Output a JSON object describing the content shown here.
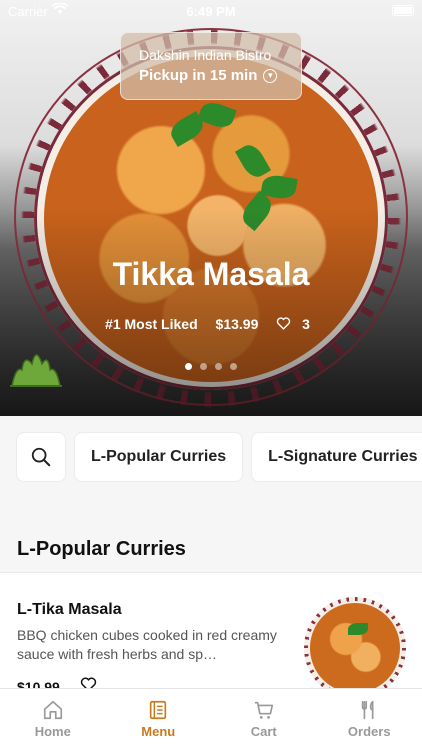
{
  "status_bar": {
    "carrier": "Carrier",
    "time": "6:49 PM"
  },
  "store": {
    "name": "Dakshin Indian Bistro",
    "pickup": "Pickup in 15 min"
  },
  "hero": {
    "title": "Tikka Masala",
    "badge": "#1 Most Liked",
    "price": "$13.99",
    "likes": "3",
    "carousel_pages": 4,
    "active_page": 1
  },
  "categories": [
    {
      "label": "L-Popular Curries"
    },
    {
      "label": "L-Signature Curries"
    }
  ],
  "section": {
    "title": "L-Popular Curries"
  },
  "item": {
    "name": "L-Tika Masala",
    "description": "BBQ chicken cubes cooked in red creamy sauce with fresh herbs and sp…",
    "price": "$10.99"
  },
  "tabs": [
    {
      "label": "Home",
      "icon": "home-icon"
    },
    {
      "label": "Menu",
      "icon": "menu-icon",
      "active": true
    },
    {
      "label": "Cart",
      "icon": "cart-icon"
    },
    {
      "label": "Orders",
      "icon": "orders-icon"
    }
  ],
  "colors": {
    "accent": "#c97a1e",
    "plate_trim": "#8b3242"
  }
}
